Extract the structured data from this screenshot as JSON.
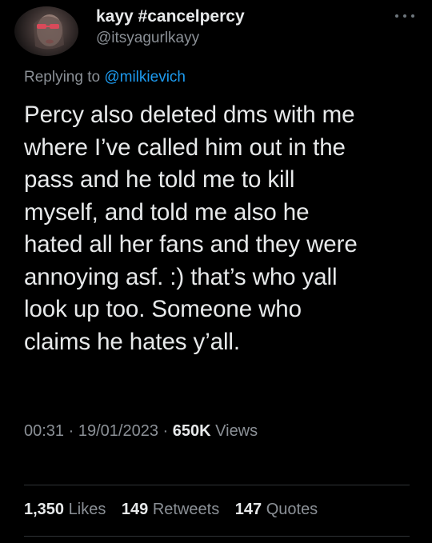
{
  "user": {
    "display_name": "kayy #cancelpercy",
    "handle": "@itsyagurlkayy"
  },
  "reply": {
    "prefix": "Replying to",
    "mention": "@milkievich"
  },
  "tweet": {
    "text": "Percy also deleted dms with me\nwhere I’ve called him out in the\npass and he told me to kill\nmyself, and told me also he\nhated all her fans and they were\nannoying asf. :) that’s who yall\nlook up too. Someone who\nclaims he hates y’all."
  },
  "meta": {
    "time": "00:31",
    "separator": "·",
    "date": "19/01/2023",
    "views_count": "650K",
    "views_label": "Views"
  },
  "stats": {
    "likes_count": "1,350",
    "likes_label": "Likes",
    "retweets_count": "149",
    "retweets_label": "Retweets",
    "quotes_count": "147",
    "quotes_label": "Quotes"
  },
  "icons": {
    "more": "more-horizontal-icon"
  },
  "colors": {
    "background": "#000000",
    "text_primary": "#e7e9ea",
    "text_secondary": "#8b9096",
    "link": "#1d9bf0",
    "divider": "#2f3336"
  }
}
